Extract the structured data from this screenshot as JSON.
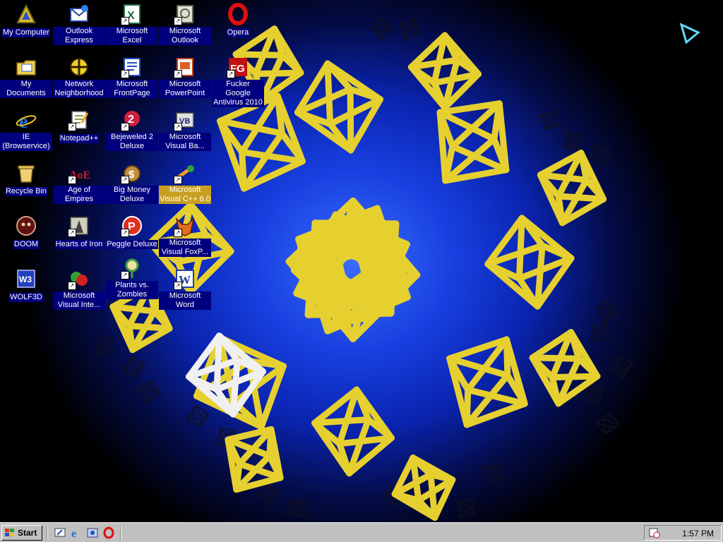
{
  "desktop": {
    "icons": [
      {
        "label": "My Computer",
        "icon": "my-computer-icon",
        "shortcut": false
      },
      {
        "label": "Outlook Express",
        "icon": "outlook-express-icon",
        "shortcut": false
      },
      {
        "label": "Microsoft Excel",
        "icon": "excel-icon",
        "shortcut": true
      },
      {
        "label": "Microsoft Outlook",
        "icon": "outlook-icon",
        "shortcut": true
      },
      {
        "label": "Opera",
        "icon": "opera-icon",
        "shortcut": false
      },
      {
        "label": "My Documents",
        "icon": "my-documents-icon",
        "shortcut": false
      },
      {
        "label": "Network Neighborhood",
        "icon": "network-neighborhood-icon",
        "shortcut": false
      },
      {
        "label": "Microsoft FrontPage",
        "icon": "frontpage-icon",
        "shortcut": true
      },
      {
        "label": "Microsoft PowerPoint",
        "icon": "powerpoint-icon",
        "shortcut": true
      },
      {
        "label": "Fucker Google Antivirus 2010",
        "icon": "antivirus-icon",
        "shortcut": true
      },
      {
        "label": "IE (Browservice)",
        "icon": "internet-explorer-icon",
        "shortcut": false
      },
      {
        "label": "Notepad++",
        "icon": "notepad-plus-plus-icon",
        "shortcut": true
      },
      {
        "label": "Bejeweled 2 Deluxe",
        "icon": "bejeweled-icon",
        "shortcut": true
      },
      {
        "label": "Microsoft Visual Ba...",
        "icon": "visual-basic-icon",
        "shortcut": true
      },
      {
        "label": "Recycle Bin",
        "icon": "recycle-bin-icon",
        "shortcut": false
      },
      {
        "label": "Age of Empires",
        "icon": "age-of-empires-icon",
        "shortcut": true
      },
      {
        "label": "Big Money Deluxe",
        "icon": "big-money-icon",
        "shortcut": true
      },
      {
        "label": "Microsoft Visual C++ 6.0",
        "icon": "visual-cpp-icon",
        "shortcut": true,
        "selected": true
      },
      {
        "label": "DOOM",
        "icon": "doom-icon",
        "shortcut": false
      },
      {
        "label": "Hearts of Iron",
        "icon": "hearts-of-iron-icon",
        "shortcut": true
      },
      {
        "label": "Peggle Deluxe",
        "icon": "peggle-icon",
        "shortcut": true
      },
      {
        "label": "Microsoft Visual FoxP...",
        "icon": "visual-foxpro-icon",
        "shortcut": true
      },
      {
        "label": "WOLF3D",
        "icon": "wolf3d-icon",
        "shortcut": false
      },
      {
        "label": "Microsoft Visual Inte...",
        "icon": "visual-interdev-icon",
        "shortcut": true
      },
      {
        "label": "Plants vs. Zombies",
        "icon": "plants-vs-zombies-icon",
        "shortcut": true
      },
      {
        "label": "Microsoft Word",
        "icon": "word-icon",
        "shortcut": true
      }
    ]
  },
  "taskbar": {
    "start_label": "Start",
    "quick_launch": [
      "show-desktop-icon",
      "internet-explorer-icon",
      "channels-icon",
      "opera-icon"
    ],
    "clock": "1:57 PM",
    "tray_icon": "task-scheduler-icon"
  },
  "colors": {
    "label_bg": "#00007e",
    "selected_bg": "#c8a020",
    "frame_yellow": "#e6d030",
    "taskbar": "#c0c0c0"
  }
}
